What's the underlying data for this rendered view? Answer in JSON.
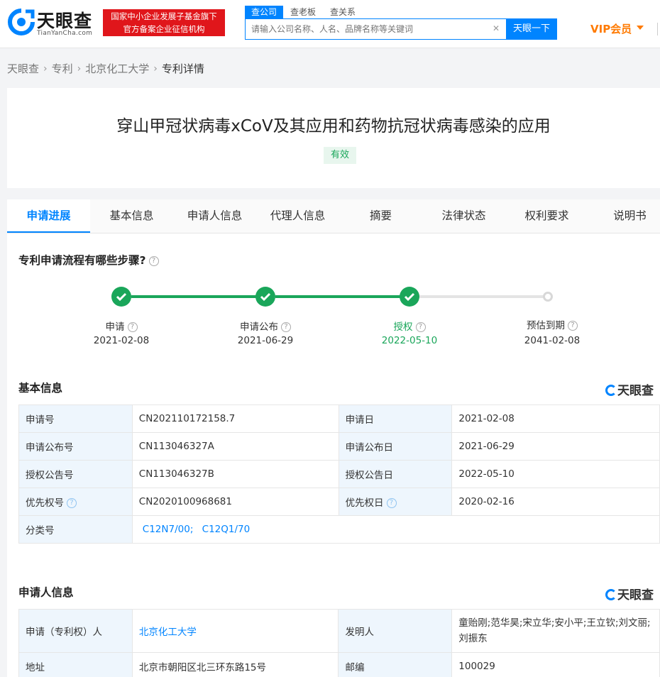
{
  "header": {
    "logo_cn": "天眼查",
    "logo_en": "TianYanCha.com",
    "banner_line1": "国家中小企业发展子基金旗下",
    "banner_line2": "官方备案企业征信机构",
    "search_tabs": [
      "查公司",
      "查老板",
      "查关系"
    ],
    "search_placeholder": "请输入公司名称、人名、品牌名称等关键词",
    "search_button": "天眼一下",
    "vip_label": "VIP会员"
  },
  "breadcrumb": [
    "天眼查",
    "专利",
    "北京化工大学",
    "专利详情"
  ],
  "patent": {
    "title": "穿山甲冠状病毒xCoV及其应用和药物抗冠状病毒感染的应用",
    "status": "有效"
  },
  "tabs": [
    "申请进展",
    "基本信息",
    "申请人信息",
    "代理人信息",
    "摘要",
    "法律状态",
    "权利要求",
    "说明书"
  ],
  "progress": {
    "title": "专利申请流程有哪些步骤?",
    "steps": [
      {
        "label": "申请",
        "date": "2021-02-08",
        "done": true
      },
      {
        "label": "申请公布",
        "date": "2021-06-29",
        "done": true
      },
      {
        "label": "授权",
        "date": "2022-05-10",
        "done": true
      },
      {
        "label": "预估到期",
        "date": "2041-02-08",
        "done": false
      }
    ]
  },
  "basic_info": {
    "title": "基本信息",
    "watermark": "天眼查",
    "rows": [
      {
        "k1": "申请号",
        "v1": "CN202110172158.7",
        "k2": "申请日",
        "v2": "2021-02-08"
      },
      {
        "k1": "申请公布号",
        "v1": "CN113046327A",
        "k2": "申请公布日",
        "v2": "2021-06-29"
      },
      {
        "k1": "授权公告号",
        "v1": "CN113046327B",
        "k2": "授权公告日",
        "v2": "2022-05-10"
      },
      {
        "k1": "优先权号",
        "v1": "CN2020100968681",
        "k2": "优先权日",
        "v2": "2020-02-16"
      }
    ],
    "class_label": "分类号",
    "class_values": [
      "C12N7/00;",
      "C12Q1/70"
    ]
  },
  "applicant_info": {
    "title": "申请人信息",
    "watermark": "天眼查",
    "applicant_label": "申请（专利权）人",
    "applicant_value": "北京化工大学",
    "inventor_label": "发明人",
    "inventor_value": "童贻刚;范华昊;宋立华;安小平;王立钦;刘文丽;刘振东",
    "address_label": "地址",
    "address_value": "北京市朝阳区北三环东路15号",
    "zip_label": "邮编",
    "zip_value": "100029"
  },
  "colors": {
    "accent": "#0084ff",
    "success": "#1aa65a",
    "banner": "#e0161b",
    "vip": "#ff7a00"
  }
}
